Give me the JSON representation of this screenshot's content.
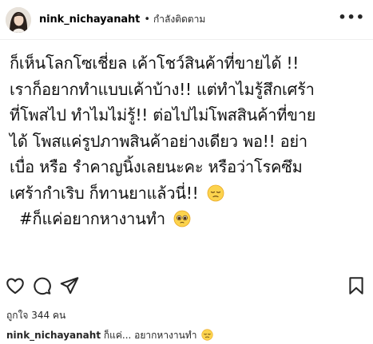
{
  "header": {
    "username": "nink_nichayanaht",
    "separator": "•",
    "follow_status": "กำลังติดตาม",
    "more": "•••"
  },
  "caption": {
    "lines": [
      "ก็เห็นโลกโซเชี่ยล เค้าโชว์สินค้าที่ขายได้ !!",
      "เราก็อยากทำแบบเค้าบ้าง!! แต่ทำไมรู้สึกเศร้า",
      "ที่โพสไป ทำไมไม่รู้!! ต่อไปไม่โพสสินค้าที่ขาย",
      "ได้ โพสแค่รูปภาพสินค้าอย่างเดียว พอ!! อย่า",
      "เบื่อ หรือ รำคาญนิ้งเลยนะคะ หรือว่าโรคซึม",
      "เศร้ากำเริบ ก็ทานยาแล้วนี่!!",
      "#ก็แค่อยากหางานทำ"
    ]
  },
  "icons": {
    "like": "heart-icon",
    "comment": "comment-icon",
    "share": "share-icon",
    "save": "bookmark-icon",
    "sad_emoji": "pensive-face-emoji",
    "pleading_emoji": "pleading-face-emoji"
  },
  "likes_text": "ถูกใจ 344 คน",
  "caption_preview": {
    "username": "nink_nichayanaht",
    "text": "ก็แค่... อยากหางานทำ"
  }
}
